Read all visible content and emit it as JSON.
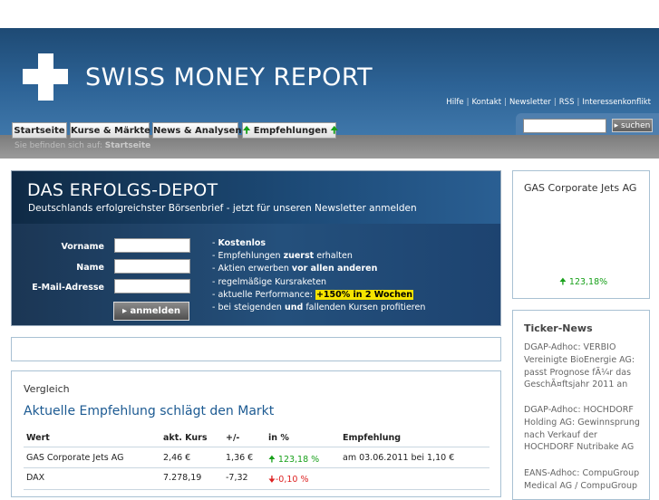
{
  "header": {
    "logo_text": "SWISS MONEY REPORT",
    "top_links": [
      "Hilfe",
      "Kontakt",
      "Newsletter",
      "RSS",
      "Interessenkonflikt"
    ],
    "search_button": "suchen",
    "search_placeholder": ""
  },
  "nav": {
    "tabs": [
      "Startseite",
      "Kurse & Märkte",
      "News & Analysen",
      "Empfehlungen"
    ],
    "breadcrumb_prefix": "Sie befinden sich auf:",
    "breadcrumb_current": "Startseite"
  },
  "banner": {
    "title": "DAS ERFOLGS-DEPOT",
    "subtitle": "Deutschlands erfolgreichster Börsenbrief - jetzt für unseren Newsletter anmelden",
    "fields": [
      "Vorname",
      "Name",
      "E-Mail-Adresse"
    ],
    "submit_label": "anmelden",
    "benefits": {
      "b1": "Kostenlos",
      "b2_a": "Empfehlungen ",
      "b2_b": "zuerst",
      "b2_c": " erhalten",
      "b3_a": "Aktien erwerben ",
      "b3_b": "vor allen anderen",
      "b4": "regelmäßige Kursraketen",
      "b5_a": "aktuelle Performance: ",
      "b5_b": "+150% in 2 Wochen",
      "b6_a": "bei steigenden ",
      "b6_b": "und",
      "b6_c": " fallenden Kursen profitieren"
    }
  },
  "comparison": {
    "label": "Vergleich",
    "heading": "Aktuelle Empfehlung schlägt den Markt",
    "columns": [
      "Wert",
      "akt. Kurs",
      "+/-",
      "in %",
      "Empfehlung"
    ],
    "rows": [
      {
        "name": "GAS Corporate Jets AG",
        "price": "2,46 €",
        "change": "1,36 €",
        "percent": "123,18 %",
        "direction": "up",
        "recommendation": "am 03.06.2011 bei 1,10 €"
      },
      {
        "name": "DAX",
        "price": "7.278,19",
        "change": "-7,32",
        "percent": "-0,10 %",
        "direction": "down",
        "recommendation": ""
      }
    ]
  },
  "sidebar": {
    "gas": {
      "title": "GAS Corporate Jets AG",
      "performance": "123,18%"
    },
    "ticker": {
      "title": "Ticker-News",
      "items": [
        "DGAP-Adhoc: VERBIO Vereinigte BioEnergie AG: passt Prognose fÃ¼r das GeschÃ¤ftsjahr 2011 an",
        "DGAP-Adhoc: HOCHDORF Holding AG: Gewinnsprung nach Verkauf der HOCHDORF Nutribake AG",
        "EANS-Adhoc: CompuGroup Medical AG / CompuGroup"
      ]
    }
  },
  "colors": {
    "header": "#2d6396",
    "heading": "#1c5a92",
    "positive": "#18a01a",
    "negative": "#d22222",
    "highlight": "#f5e400"
  },
  "icons": {
    "search_button": "triangle-right-icon",
    "tab_arrows": "arrow-up-icon",
    "submit": "triangle-right-icon"
  }
}
